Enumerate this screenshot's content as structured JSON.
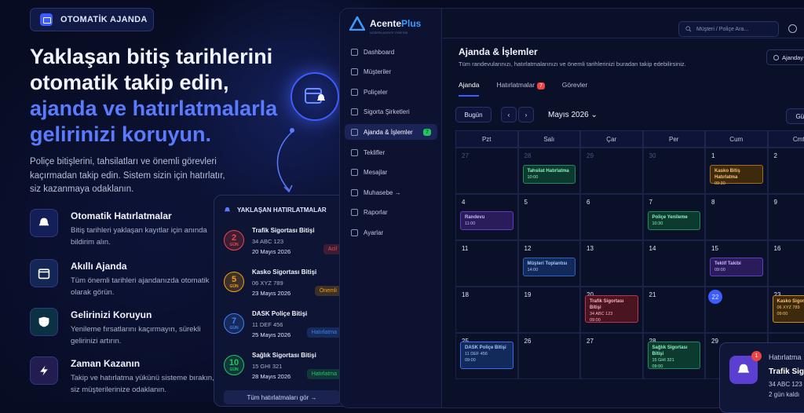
{
  "badge": {
    "label": "OTOMATİK AJANDA"
  },
  "hero": {
    "line1": "Yaklaşan bitiş tarihlerini",
    "line2": "otomatik takip edin,",
    "line3": "ajanda ve hatırlatmalarla",
    "line4": "gelirinizi koruyun."
  },
  "description": "Poliçe bitişlerini, tahsilatları ve önemli görevleri kaçırmadan takip edin. Sistem sizin için hatırlatır, siz kazanmaya odaklanın.",
  "features": [
    {
      "title": "Otomatik Hatırlatmalar",
      "desc": "Bitiş tarihleri yaklaşan kayıtlar için anında bildirim alın.",
      "icon": "bell-icon",
      "color": "#3b5cff"
    },
    {
      "title": "Akıllı Ajanda",
      "desc": "Tüm önemli tarihleri ajandanızda otomatik olarak görün.",
      "icon": "calendar-icon",
      "color": "#3b82f6"
    },
    {
      "title": "Gelirinizi Koruyun",
      "desc": "Yenileme fırsatlarını kaçırmayın, sürekli gelirinizi artırın.",
      "icon": "shield-icon",
      "color": "#14b8a6"
    },
    {
      "title": "Zaman Kazanın",
      "desc": "Takip ve hatırlatma yükünü sisteme bırakın, siz müşterilerinize odaklanın.",
      "icon": "lightning-icon",
      "color": "#8b5cf6"
    }
  ],
  "reminders": {
    "title": "YAKLAŞAN HATIRLATMALAR",
    "items": [
      {
        "days": "2",
        "unit": "GÜN",
        "title": "Trafik Sigortası Bitişi",
        "plate": "34 ABC 123",
        "date": "20 Mayıs 2026",
        "tag": "Acil",
        "color": "#ef4444"
      },
      {
        "days": "5",
        "unit": "GÜN",
        "title": "Kasko Sigortası Bitişi",
        "plate": "06 XYZ 789",
        "date": "23 Mayıs 2026",
        "tag": "Önemli",
        "color": "#f59e0b"
      },
      {
        "days": "7",
        "unit": "GÜN",
        "title": "DASK Poliçe Bitişi",
        "plate": "11 DEF 456",
        "date": "25 Mayıs 2026",
        "tag": "Hatırlatma",
        "color": "#3b82f6"
      },
      {
        "days": "10",
        "unit": "GÜN",
        "title": "Sağlık Sigortası Bitişi",
        "plate": "15 GHI 321",
        "date": "28 Mayıs 2026",
        "tag": "Hatırlatma",
        "color": "#22c55e"
      }
    ],
    "footer": "Tüm hatırlatmaları gör  →"
  },
  "app": {
    "brand1": "Acente",
    "brand2": "Plus",
    "brand_sub": "MODERN ACENTE YÖNETİMİ",
    "nav": [
      {
        "label": "Dashboard"
      },
      {
        "label": "Müşteriler"
      },
      {
        "label": "Poliçeler"
      },
      {
        "label": "Sigorta Şirketleri"
      },
      {
        "label": "Ajanda & İşlemler",
        "count": "7",
        "active": true
      },
      {
        "label": "Teklifler"
      },
      {
        "label": "Mesajlar"
      },
      {
        "label": "Muhasebe  →"
      },
      {
        "label": "Raporlar"
      },
      {
        "label": "Ayarlar"
      }
    ],
    "search_placeholder": "Müşteri / Poliçe Ara...",
    "page_title": "Ajanda & İşlemler",
    "page_sub": "Tüm randevularınızı, hatırlatmalarınızı ve önemli tarihlerinizi buradan takip edebilirsiniz.",
    "ajanda_btn": "Ajanday",
    "tabs": [
      {
        "label": "Ajanda"
      },
      {
        "label": "Hatırlatmalar",
        "badge": "7"
      },
      {
        "label": "Görevler"
      }
    ],
    "today_btn": "Bugün",
    "month": "Mayıs 2026",
    "gun_btn": "Gün",
    "days": [
      "Pzt",
      "Salı",
      "Çar",
      "Per",
      "Cum",
      "Cmt"
    ],
    "weeks": [
      [
        "27",
        "28",
        "29",
        "30",
        "1",
        "2"
      ],
      [
        "4",
        "5",
        "6",
        "7",
        "8",
        "9"
      ],
      [
        "11",
        "12",
        "13",
        "14",
        "15",
        "16"
      ],
      [
        "18",
        "19",
        "20",
        "21",
        "22",
        "23"
      ],
      [
        "25",
        "26",
        "27",
        "28",
        "29",
        ""
      ]
    ],
    "events": [
      {
        "w": 0,
        "d": 1,
        "title": "Tahsilat Hatırlatma",
        "sub": "10:00",
        "bg": "#0d3a2e",
        "bd": "#1f8a5e",
        "fg": "#8df0c0"
      },
      {
        "w": 0,
        "d": 4,
        "title": "Kasko Bitiş Hatırlatma",
        "sub": "09:30",
        "bg": "#3d2a0d",
        "bd": "#a66a1a",
        "fg": "#ffc26b"
      },
      {
        "w": 1,
        "d": 0,
        "title": "Randevu",
        "sub": "11:00",
        "bg": "#2a1c5a",
        "bd": "#5b3fbf",
        "fg": "#c8b5ff"
      },
      {
        "w": 1,
        "d": 3,
        "title": "Poliçe Yenileme",
        "sub": "10:30",
        "bg": "#0d3a2e",
        "bd": "#1f8a5e",
        "fg": "#8df0c0"
      },
      {
        "w": 2,
        "d": 1,
        "title": "Müşteri Toplantısı",
        "sub": "14:00",
        "bg": "#112a5a",
        "bd": "#2f5fbf",
        "fg": "#a8c5ff"
      },
      {
        "w": 2,
        "d": 4,
        "title": "Teklif Takibi",
        "sub": "09:00",
        "bg": "#2a1c5a",
        "bd": "#5b3fbf",
        "fg": "#c8b5ff"
      },
      {
        "w": 3,
        "d": 2,
        "title": "Trafik Sigortası Bitişi",
        "sub": "34 ABC 123",
        "sub2": "09:00",
        "bg": "#4a1420",
        "bd": "#c0334a",
        "fg": "#ffb3bf"
      },
      {
        "w": 3,
        "d": 5,
        "title": "Kasko Sigortası",
        "sub": "06 XYZ 789",
        "sub2": "09:00",
        "bg": "#3d2a0d",
        "bd": "#d08a1a",
        "fg": "#ffc26b"
      },
      {
        "w": 4,
        "d": 0,
        "title": "DASK Poliçe Bitişi",
        "sub": "11 DEF 456",
        "sub2": "09:00",
        "bg": "#112a5a",
        "bd": "#3b6cf0",
        "fg": "#a8c5ff"
      },
      {
        "w": 4,
        "d": 3,
        "title": "Sağlık Sigortası Bitişi",
        "sub": "15 GHI 321",
        "sub2": "09:00",
        "bg": "#0d3a2e",
        "bd": "#1f8a5e",
        "fg": "#8df0c0"
      }
    ],
    "today_day": "22"
  },
  "notification": {
    "badge": "1",
    "title": "Hatırlatma",
    "item": "Trafik Sigor",
    "plate": "34 ABC 123",
    "left": "2 gün kaldı"
  }
}
